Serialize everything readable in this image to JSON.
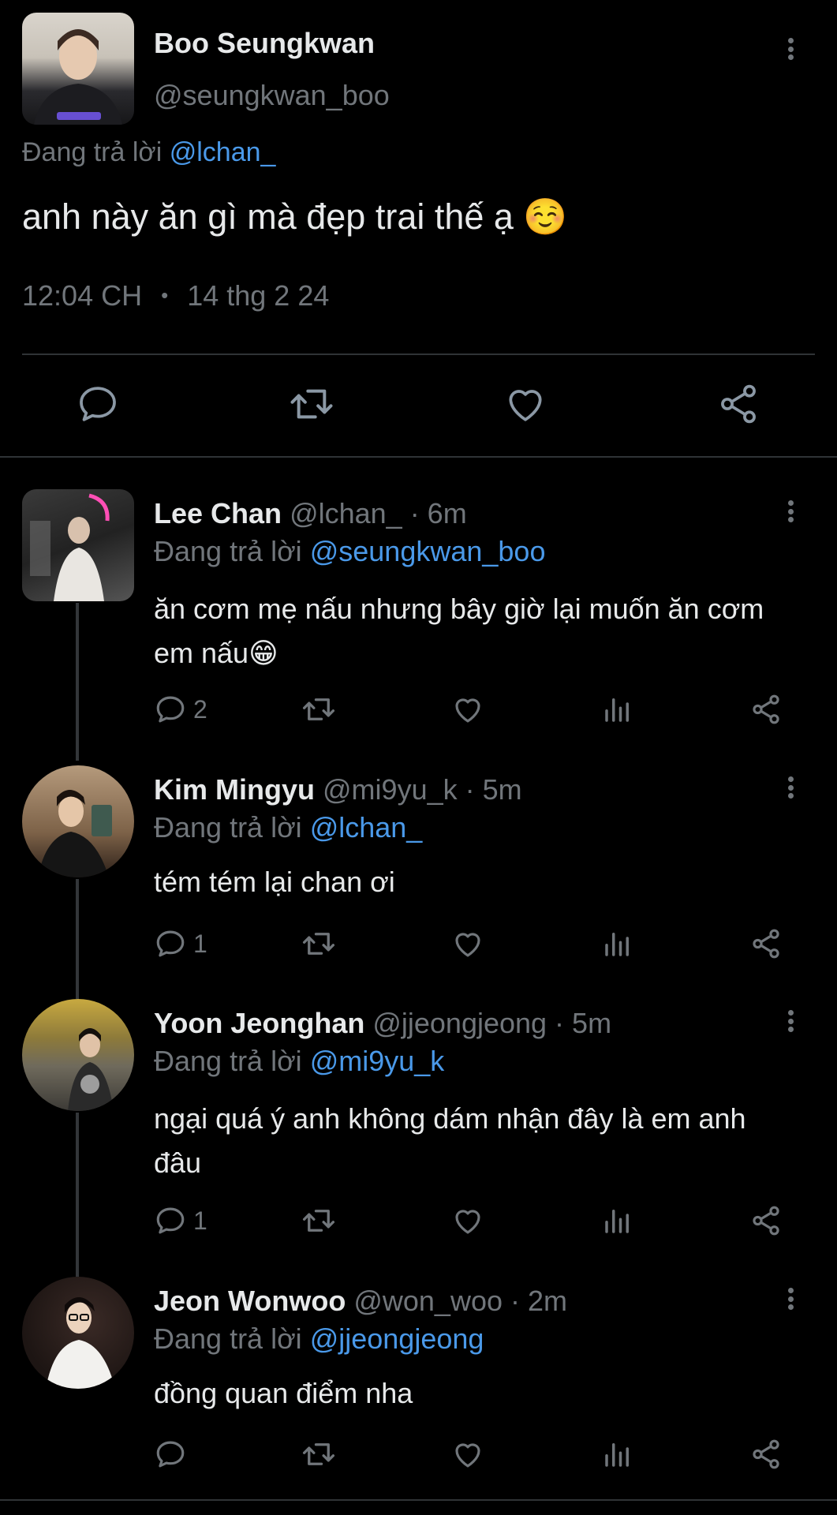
{
  "main_tweet": {
    "name": "Boo Seungkwan",
    "handle": "@seungkwan_boo",
    "replying_prefix": "Đang trả lời",
    "replying_to": "@lchan_",
    "text": "anh này ăn gì mà đẹp trai thế ạ ☺️",
    "time": "12:04 CH",
    "separator": "•",
    "date": "14 thg 2 24"
  },
  "replies": [
    {
      "name": "Lee Chan",
      "meta": "@lchan_ · 6m",
      "replying_prefix": "Đang trả lời",
      "replying_to": "@seungkwan_boo",
      "text": "ăn cơm mẹ nấu nhưng bây giờ lại muốn ăn cơm em nấu😁",
      "reply_count": "2"
    },
    {
      "name": "Kim Mingyu",
      "meta": "@mi9yu_k · 5m",
      "replying_prefix": "Đang trả lời",
      "replying_to": "@lchan_",
      "text": "tém tém lại chan ơi",
      "reply_count": "1"
    },
    {
      "name": "Yoon Jeonghan",
      "meta": "@jjeongjeong · 5m",
      "replying_prefix": "Đang trả lời",
      "replying_to": "@mi9yu_k",
      "text": "ngại quá ý anh không dám nhận đây là em anh đâu",
      "reply_count": "1"
    },
    {
      "name": "Jeon Wonwoo",
      "meta": "@won_woo · 2m",
      "replying_prefix": "Đang trả lời",
      "replying_to": "@jjeongjeong",
      "text": "đồng quan điểm nha",
      "reply_count": ""
    }
  ],
  "icons": {
    "reply": "reply-icon",
    "retweet": "retweet-icon",
    "like": "heart-icon",
    "views": "views-icon",
    "share": "share-icon",
    "more": "more-vertical-icon"
  },
  "colors": {
    "background": "#000000",
    "text": "#e7e9ea",
    "muted": "#71767b",
    "link": "#4a99e9",
    "divider": "#2f3336"
  }
}
